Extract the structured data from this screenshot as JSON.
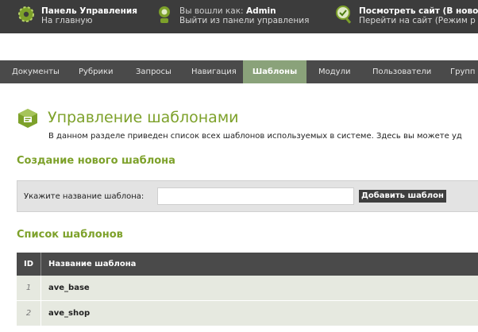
{
  "topbar": {
    "panel": {
      "title": "Панель Управления",
      "subtitle": "На главную"
    },
    "user": {
      "label": "Вы вошли как:",
      "name": "Admin",
      "logout": "Выйти из панели управления"
    },
    "site": {
      "title": "Посмотреть сайт (В новом",
      "subtitle": "Перейти на сайт (Режим р"
    }
  },
  "nav": {
    "items": [
      {
        "label": "Документы"
      },
      {
        "label": "Рубрики"
      },
      {
        "label": "Запросы"
      },
      {
        "label": "Навигация"
      },
      {
        "label": "Шаблоны"
      },
      {
        "label": "Модули"
      },
      {
        "label": "Пользователи"
      },
      {
        "label": "Групп"
      }
    ],
    "active_index": 4
  },
  "page": {
    "title": "Управление шаблонами",
    "description": "В данном разделе приведен список всех шаблонов используемых в системе. Здесь вы можете уд"
  },
  "create": {
    "section_title": "Создание нового шаблона",
    "label": "Укажите название шаблона:",
    "input_value": "",
    "button": "Добавить шаблон"
  },
  "list": {
    "section_title": "Список шаблонов",
    "columns": [
      "ID",
      "Название шаблона"
    ],
    "rows": [
      {
        "id": "1",
        "name": "ave_base"
      },
      {
        "id": "2",
        "name": "ave_shop"
      }
    ]
  },
  "colors": {
    "topbar_bg": "#3c3c3c",
    "nav_bg": "#4a4a4a",
    "nav_active_bg": "#8aa27a",
    "heading_green": "#7da12a",
    "row_bg": "#e6e9e0"
  }
}
